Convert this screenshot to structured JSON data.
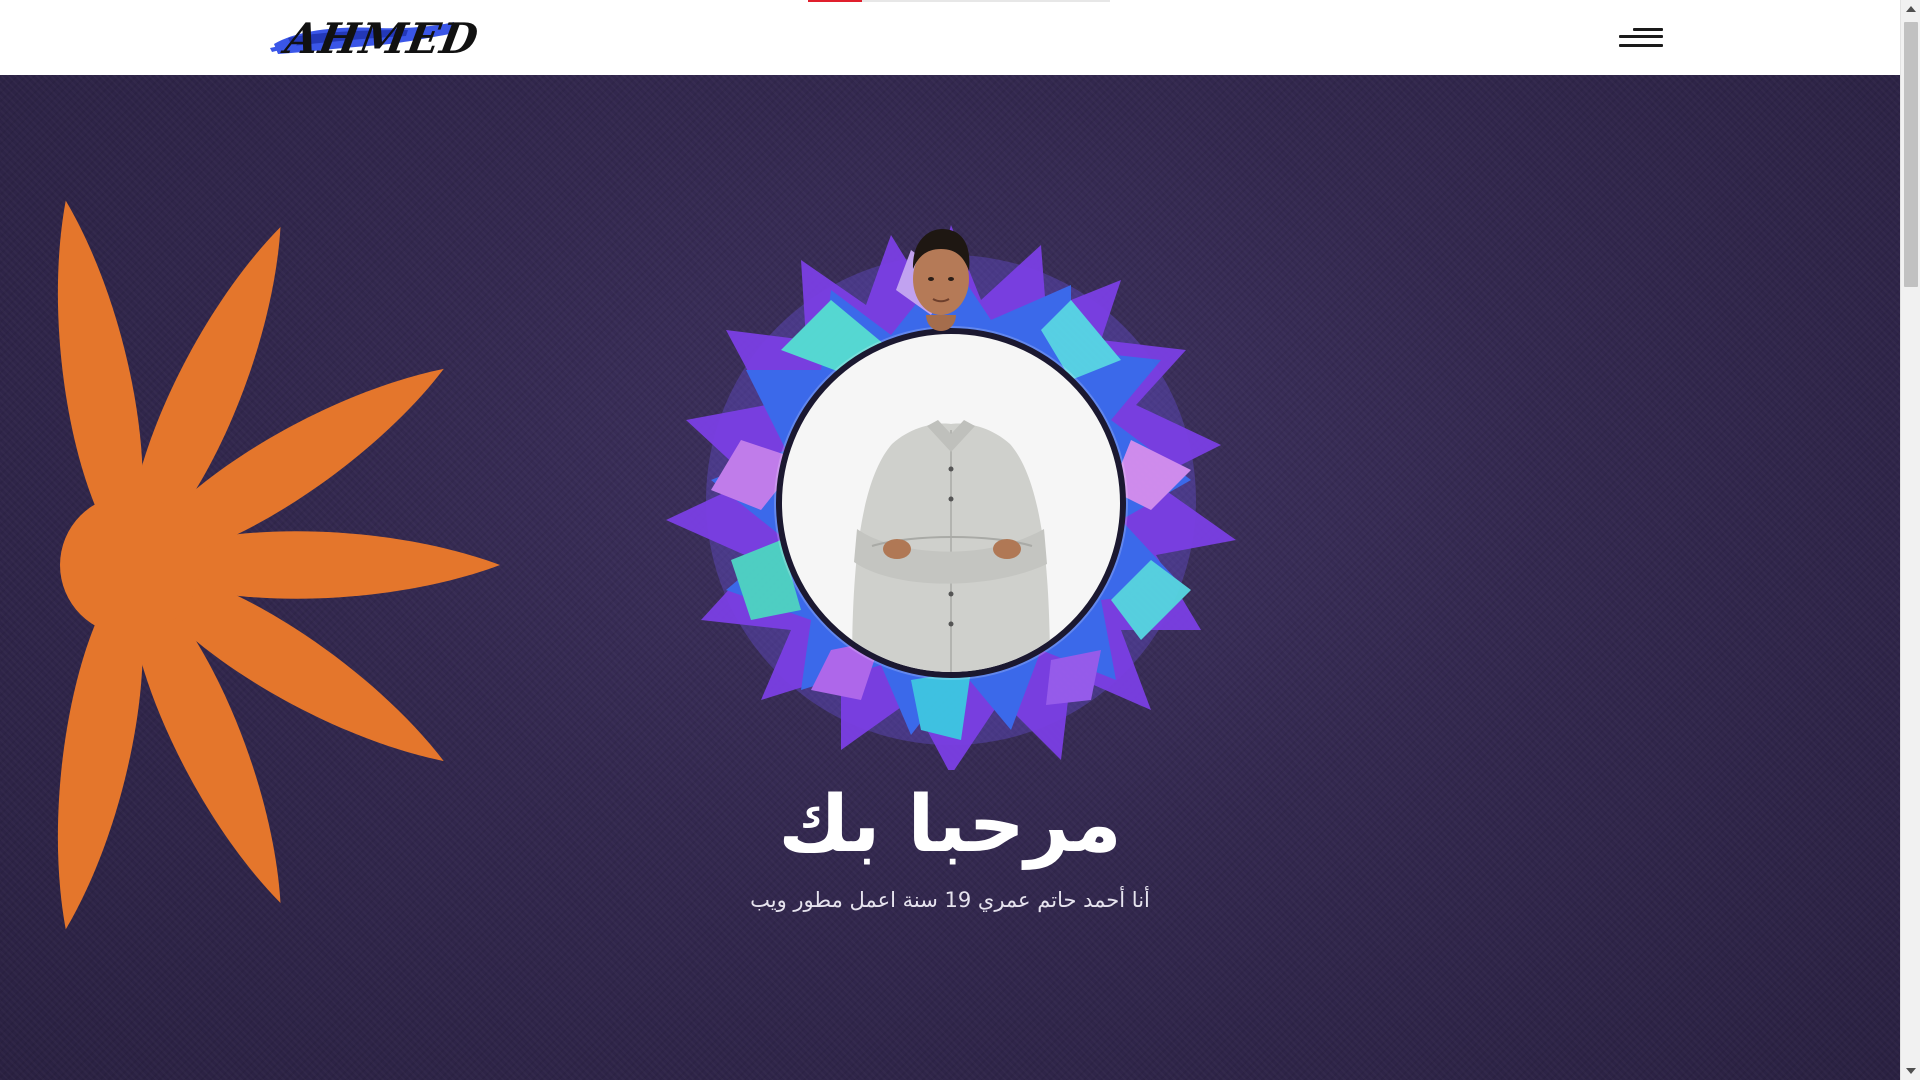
{
  "header": {
    "logo_text": "AHMED",
    "menu_icon": "hamburger-menu-icon"
  },
  "loading_bar": {
    "progress_percent": 18,
    "color": "#e01f2d"
  },
  "hero": {
    "title": "مرحبا بك",
    "subtitle": "أنا أحمد حاتم عمري 19 سنة اعمل مطور ويب",
    "scroll_icon": "double-chevron-down-icon",
    "accent_color": "#e4762c",
    "background_color": "#342a52"
  },
  "colors": {
    "scroll_indicator": "#e01f2d",
    "flower": "#e4762c",
    "logo_brush": "#3a56e8"
  }
}
